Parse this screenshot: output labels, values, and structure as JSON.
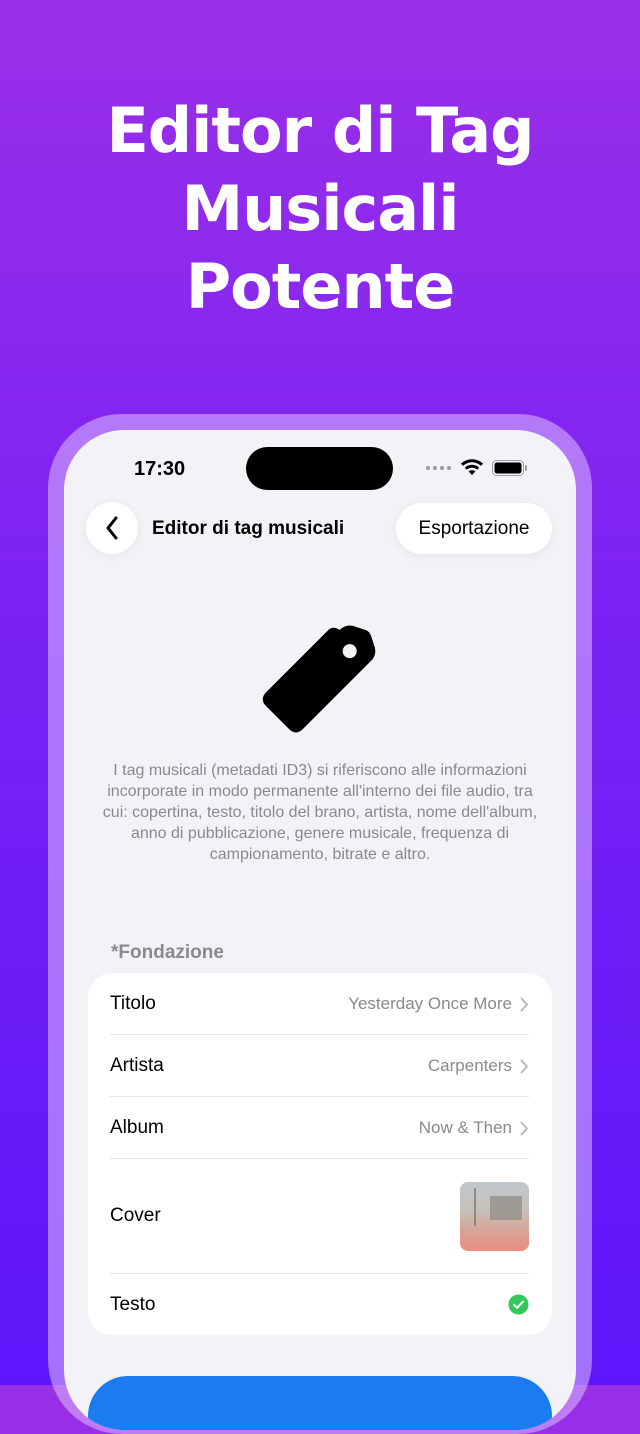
{
  "headline": {
    "line1": "Editor di Tag",
    "line2": "Musicali",
    "line3": "Potente"
  },
  "status_bar": {
    "time": "17:30"
  },
  "nav": {
    "title": "Editor di tag musicali",
    "export_label": "Esportazione"
  },
  "description": "I tag musicali (metadati ID3) si riferiscono alle informazioni incorporate in modo permanente all'interno dei file audio, tra cui: copertina, testo, titolo del brano, artista, nome dell'album, anno di pubblicazione, genere musicale, frequenza di campionamento, bitrate e altro.",
  "section": {
    "header": "*Fondazione",
    "rows": [
      {
        "label": "Titolo",
        "value": "Yesterday Once More"
      },
      {
        "label": "Artista",
        "value": "Carpenters"
      },
      {
        "label": "Album",
        "value": "Now & Then"
      },
      {
        "label": "Cover",
        "value": ""
      },
      {
        "label": "Testo",
        "value": ""
      }
    ]
  },
  "colors": {
    "accent": "#1a7cf0",
    "check_green": "#34c759",
    "background_top": "#9a2fe8",
    "background_bottom": "#5d16fa"
  },
  "icons": {
    "back": "chevron-left-icon",
    "tag": "tag-icon",
    "row_chevron": "chevron-right-icon",
    "lyrics_status": "checkmark-circle-icon"
  }
}
